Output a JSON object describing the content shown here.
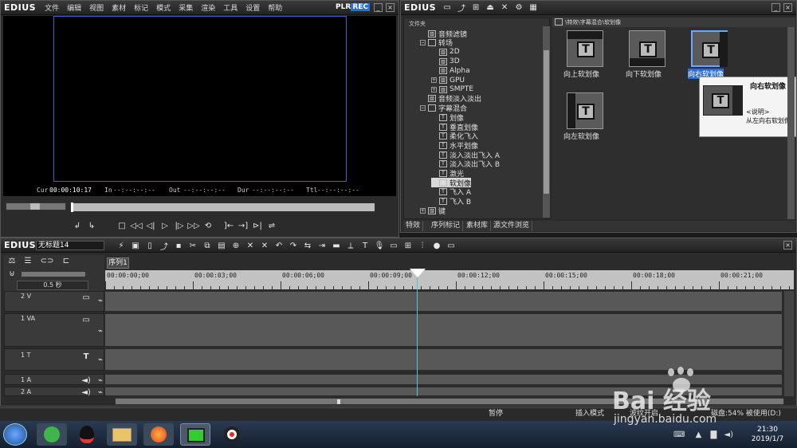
{
  "player": {
    "brand": "EDIUS",
    "menu": [
      "文件",
      "编辑",
      "视图",
      "素材",
      "标记",
      "模式",
      "采集",
      "渲染",
      "工具",
      "设置",
      "帮助"
    ],
    "plr": "PLR",
    "rec": "REC",
    "cur_label": "Cur",
    "cur_value": "00:00:10:17",
    "in_label": "In",
    "in_value": "--:--:--:--",
    "out_label": "Out",
    "out_value": "--:--:--:--",
    "dur_label": "Dur",
    "dur_value": "--:--:--:--",
    "ttl_label": "Ttl",
    "ttl_value": "--:--:--:--"
  },
  "bin": {
    "brand": "EDIUS",
    "folder_header": "文件夹",
    "path": "\\特效\\字幕混合\\软划像",
    "tree": [
      {
        "label": "音频滤镜",
        "level": 1,
        "expander": "",
        "icon": "fx"
      },
      {
        "label": "转场",
        "level": 1,
        "expander": "−",
        "icon": "folder"
      },
      {
        "label": "2D",
        "level": 2,
        "expander": "",
        "icon": "fx"
      },
      {
        "label": "3D",
        "level": 2,
        "expander": "",
        "icon": "fx"
      },
      {
        "label": "Alpha",
        "level": 2,
        "expander": "",
        "icon": "fx"
      },
      {
        "label": "GPU",
        "level": 2,
        "expander": "+",
        "icon": "fx"
      },
      {
        "label": "SMPTE",
        "level": 2,
        "expander": "+",
        "icon": "fx"
      },
      {
        "label": "音频淡入淡出",
        "level": 1,
        "expander": "",
        "icon": "fx"
      },
      {
        "label": "字幕混合",
        "level": 1,
        "expander": "−",
        "icon": "folder"
      },
      {
        "label": "划像",
        "level": 2,
        "expander": "",
        "icon": "T"
      },
      {
        "label": "垂直划像",
        "level": 2,
        "expander": "",
        "icon": "T"
      },
      {
        "label": "柔化飞入",
        "level": 2,
        "expander": "",
        "icon": "T"
      },
      {
        "label": "水平划像",
        "level": 2,
        "expander": "",
        "icon": "T"
      },
      {
        "label": "淡入淡出飞入 A",
        "level": 2,
        "expander": "",
        "icon": "T"
      },
      {
        "label": "淡入淡出飞入 B",
        "level": 2,
        "expander": "",
        "icon": "T"
      },
      {
        "label": "激光",
        "level": 2,
        "expander": "",
        "icon": "T"
      },
      {
        "label": "软划像",
        "level": 2,
        "expander": "",
        "icon": "T",
        "selected": true
      },
      {
        "label": "飞入 A",
        "level": 2,
        "expander": "",
        "icon": "T"
      },
      {
        "label": "飞入 B",
        "level": 2,
        "expander": "",
        "icon": "T"
      },
      {
        "label": "键",
        "level": 1,
        "expander": "+",
        "icon": "fx"
      }
    ],
    "items": [
      {
        "label": "向上软划像",
        "dir": "up"
      },
      {
        "label": "向下软划像",
        "dir": "down"
      },
      {
        "label": "向右软划像",
        "dir": "right",
        "selected": true
      },
      {
        "label": "向左软划像",
        "dir": "left"
      }
    ],
    "tooltip": {
      "title": "向右软划像",
      "desc_label": "<说明>",
      "desc": "从左向右软划像"
    },
    "tabs": [
      "特效",
      "序列标记",
      "素材库",
      "源文件浏览"
    ]
  },
  "timeline": {
    "brand": "EDIUS",
    "project": "无标题14",
    "sequence_tab": "序列1",
    "scale": "0.5 秒",
    "ruler": [
      "00:00:00;00",
      "00:00:03;00",
      "00:00:06;00",
      "00:00:09;00",
      "00:00:12;00",
      "00:00:15;00",
      "00:00:18;00",
      "00:00:21;00"
    ],
    "tracks": [
      {
        "name": "2 V"
      },
      {
        "name": "1 VA"
      },
      {
        "name": "1 T"
      },
      {
        "name": "1 A"
      },
      {
        "name": "2 A"
      }
    ]
  },
  "status": {
    "pause": "暂停",
    "insert": "插入模式",
    "ripple": "波纹开启",
    "disk": "磁盘:54% 被使用(D:)"
  },
  "taskbar": {
    "time": "21:30",
    "date": "2019/1/7"
  },
  "watermark": {
    "text": "Bai 经验",
    "url": "jingyan.baidu.com"
  },
  "colors": {
    "accent": "#2a6fd6",
    "cursor": "#5ec0d8",
    "panel": "#2e2e2e"
  }
}
